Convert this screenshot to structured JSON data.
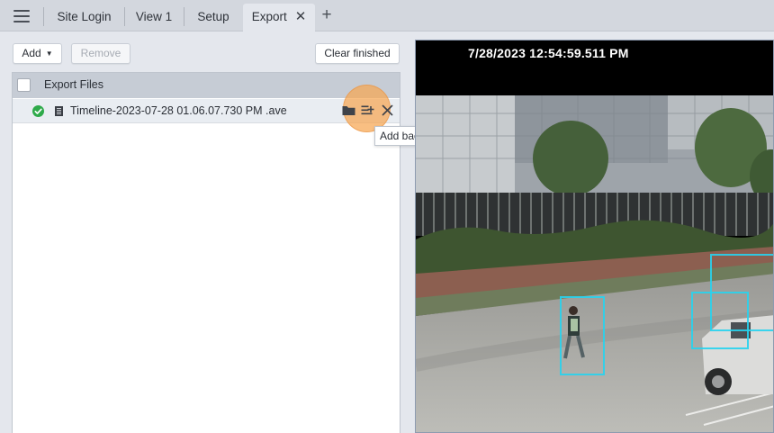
{
  "tabs": [
    {
      "label": "Site Login"
    },
    {
      "label": "View 1"
    },
    {
      "label": "Setup"
    },
    {
      "label": "Export",
      "active": true
    }
  ],
  "toolbar": {
    "add_label": "Add",
    "remove_label": "Remove",
    "clear_label": "Clear finished"
  },
  "list": {
    "header": "Export Files",
    "rows": [
      {
        "status": "complete",
        "file_name": "Timeline-2023-07-28 01.06.07.730 PM .ave"
      }
    ]
  },
  "tooltip": "Add back to export list",
  "video": {
    "timestamp": "7/28/2023 12:54:59.511 PM"
  },
  "colors": {
    "accent_highlight": "#f6a652",
    "status_ok": "#2eaa4a",
    "detection_box": "#27d3ee"
  },
  "icons": [
    "menu-icon",
    "close-icon",
    "plus-icon",
    "check-circle-icon",
    "film-icon",
    "folder-icon",
    "list-add-icon"
  ]
}
